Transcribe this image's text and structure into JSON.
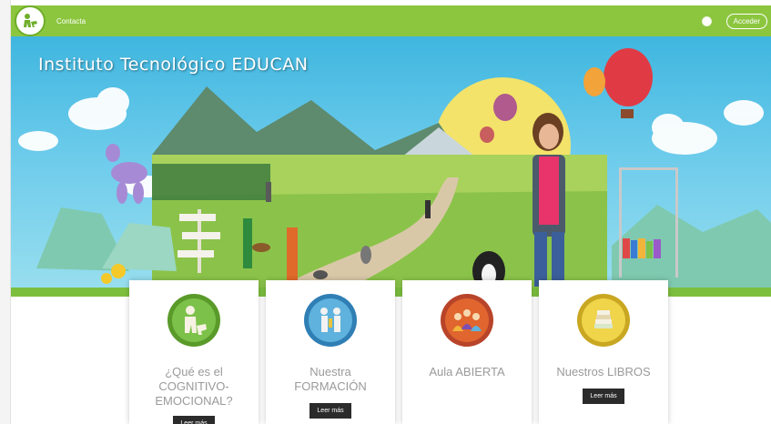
{
  "header": {
    "nav_contact": "Contacta",
    "login_label": "Acceder"
  },
  "hero": {
    "title": "Instituto Tecnológico EDUCAN"
  },
  "cards": [
    {
      "icon": "dog-trainer-icon",
      "title_lines": [
        "¿Qué es el",
        "COGNITIVO-",
        "EMOCIONAL?"
      ],
      "button": "Leer más"
    },
    {
      "icon": "people-icon",
      "title_lines": [
        "Nuestra",
        "FORMACIÓN"
      ],
      "button": "Leer más"
    },
    {
      "icon": "group-icon",
      "title_lines": [
        "Aula ABIERTA"
      ],
      "button": ""
    },
    {
      "icon": "books-icon",
      "title_lines": [
        "Nuestros LIBROS"
      ],
      "button": "Leer más"
    }
  ],
  "colors": {
    "brand_green": "#8cc63f",
    "sky": "#3fb6df",
    "meadow": "#8bc34a",
    "button_dark": "#2b2b2b"
  }
}
